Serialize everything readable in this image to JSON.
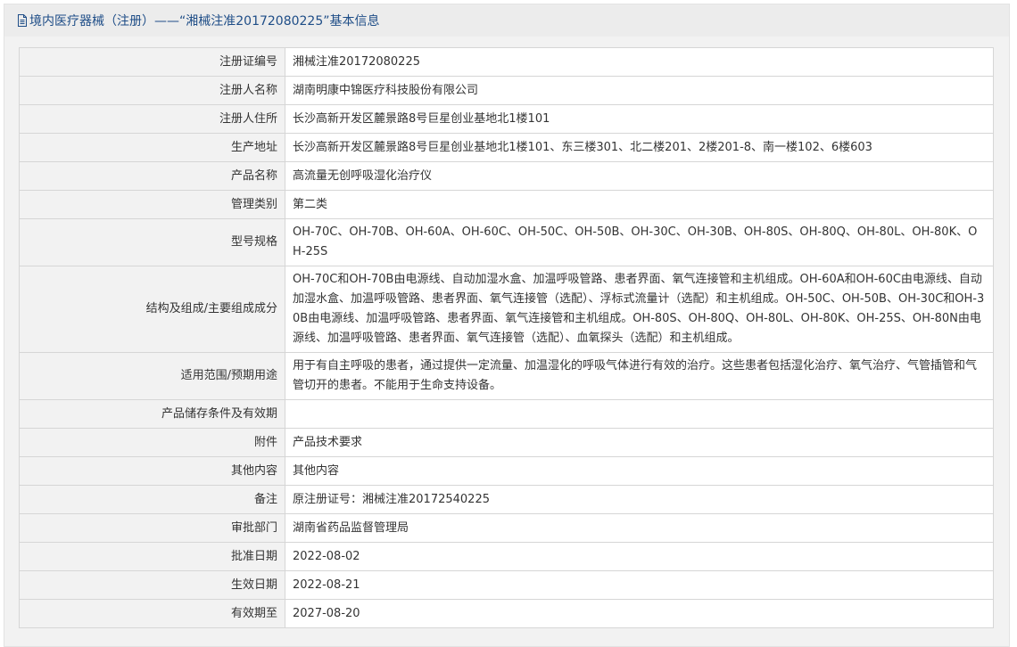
{
  "header": {
    "title": "境内医疗器械（注册）——“湘械注准20172080225”基本信息"
  },
  "rows": [
    {
      "label": "注册证编号",
      "value": "湘械注准20172080225"
    },
    {
      "label": "注册人名称",
      "value": "湖南明康中锦医疗科技股份有限公司"
    },
    {
      "label": "注册人住所",
      "value": "长沙高新开发区麓景路8号巨星创业基地北1楼101"
    },
    {
      "label": "生产地址",
      "value": "长沙高新开发区麓景路8号巨星创业基地北1楼101、东三楼301、北二楼201、2楼201-8、南一楼102、6楼603"
    },
    {
      "label": "产品名称",
      "value": "高流量无创呼吸湿化治疗仪"
    },
    {
      "label": "管理类别",
      "value": "第二类"
    },
    {
      "label": "型号规格",
      "value": "OH-70C、OH-70B、OH-60A、OH-60C、OH-50C、OH-50B、OH-30C、OH-30B、OH-80S、OH-80Q、OH-80L、OH-80K、OH-25S"
    },
    {
      "label": "结构及组成/主要组成成分",
      "value": "OH-70C和OH-70B由电源线、自动加湿水盒、加温呼吸管路、患者界面、氧气连接管和主机组成。OH-60A和OH-60C由电源线、自动加湿水盒、加温呼吸管路、患者界面、氧气连接管（选配）、浮标式流量计（选配）和主机组成。OH-50C、OH-50B、OH-30C和OH-30B由电源线、加温呼吸管路、患者界面、氧气连接管和主机组成。OH-80S、OH-80Q、OH-80L、OH-80K、OH-25S、OH-80N由电源线、加温呼吸管路、患者界面、氧气连接管（选配）、血氧探头（选配）和主机组成。"
    },
    {
      "label": "适用范围/预期用途",
      "value": "用于有自主呼吸的患者，通过提供一定流量、加温湿化的呼吸气体进行有效的治疗。这些患者包括湿化治疗、氧气治疗、气管插管和气管切开的患者。不能用于生命支持设备。"
    },
    {
      "label": "产品储存条件及有效期",
      "value": ""
    },
    {
      "label": "附件",
      "value": "产品技术要求"
    },
    {
      "label": "其他内容",
      "value": "其他内容"
    },
    {
      "label": "备注",
      "value": "原注册证号：湘械注准20172540225"
    },
    {
      "label": "审批部门",
      "value": "湖南省药品监督管理局"
    },
    {
      "label": "批准日期",
      "value": "2022-08-02"
    },
    {
      "label": "生效日期",
      "value": "2022-08-21"
    },
    {
      "label": "有效期至",
      "value": "2027-08-20"
    }
  ]
}
